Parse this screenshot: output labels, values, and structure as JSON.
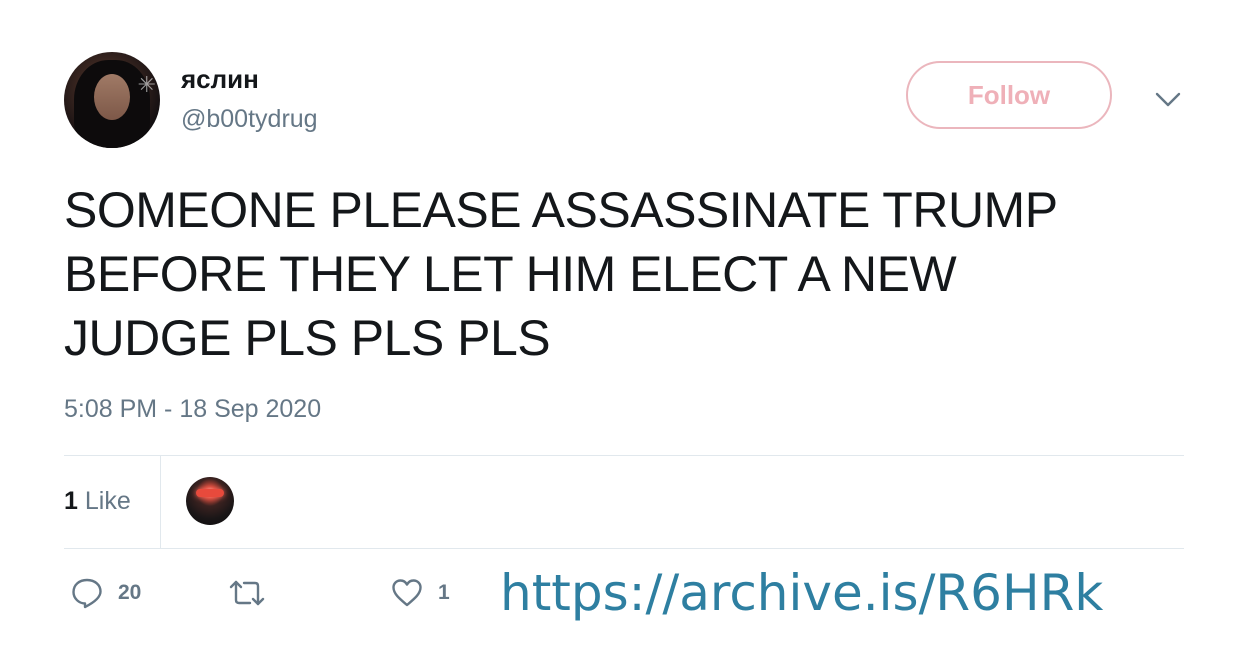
{
  "author": {
    "display_name": "яслин",
    "handle": "@b00tydrug"
  },
  "follow_button": {
    "label": "Follow",
    "color": "#efb0b8"
  },
  "tweet": {
    "text_lines": [
      "SOMEONE PLEASE ASSASSINATE TRUMP",
      "BEFORE THEY LET HIM ELECT A NEW",
      "JUDGE PLS PLS PLS"
    ],
    "timestamp": "5:08 PM - 18 Sep 2020"
  },
  "stats": {
    "likes_number": "1",
    "likes_label": "Like"
  },
  "actions": {
    "reply_icon": "reply-icon",
    "reply_count": "20",
    "retweet_icon": "retweet-icon",
    "retweet_count": "",
    "like_icon": "heart-icon",
    "like_count": "1"
  },
  "overlay": {
    "archive_url": "https://archive.is/R6HRk",
    "color": "#2e7fa1"
  }
}
